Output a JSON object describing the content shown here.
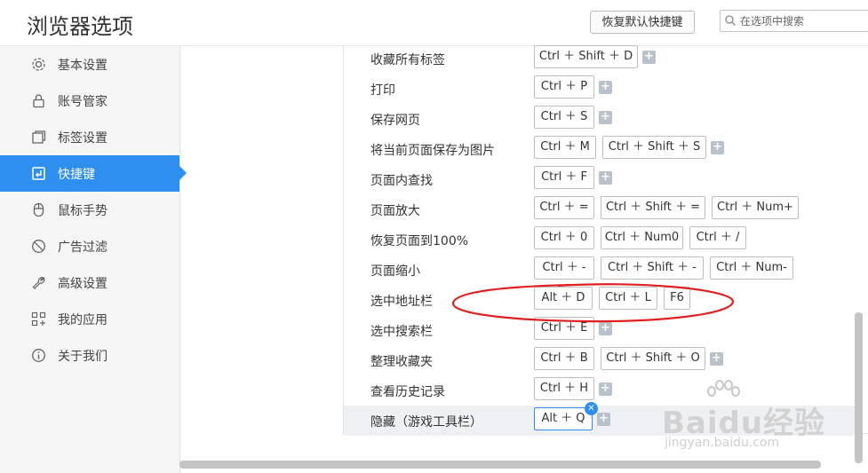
{
  "app": {
    "title": "浏览器选项"
  },
  "header": {
    "restore_button": "恢复默认快捷键",
    "search_placeholder": "在选项中搜索"
  },
  "sidebar": {
    "items": [
      {
        "label": "基本设置",
        "icon": "gear-icon"
      },
      {
        "label": "账号管家",
        "icon": "lock-icon"
      },
      {
        "label": "标签设置",
        "icon": "tabs-icon"
      },
      {
        "label": "快捷键",
        "icon": "shortcut-icon",
        "active": true
      },
      {
        "label": "鼠标手势",
        "icon": "mouse-icon"
      },
      {
        "label": "广告过滤",
        "icon": "block-icon"
      },
      {
        "label": "高级设置",
        "icon": "wrench-icon"
      },
      {
        "label": "我的应用",
        "icon": "apps-icon"
      },
      {
        "label": "关于我们",
        "icon": "info-icon"
      }
    ]
  },
  "shortcuts": [
    {
      "label": "收藏所有标签",
      "keys": [
        "Ctrl ＋ Shift ＋ D"
      ]
    },
    {
      "label": "打印",
      "keys": [
        "Ctrl ＋ P"
      ]
    },
    {
      "label": "保存网页",
      "keys": [
        "Ctrl ＋ S"
      ]
    },
    {
      "label": "将当前页面保存为图片",
      "keys": [
        "Ctrl ＋ M",
        "Ctrl ＋ Shift ＋ S"
      ]
    },
    {
      "label": "页面内查找",
      "keys": [
        "Ctrl ＋ F"
      ]
    },
    {
      "label": "页面放大",
      "keys": [
        "Ctrl ＋ =",
        "Ctrl ＋ Shift ＋ =",
        "Ctrl ＋ Num+"
      ]
    },
    {
      "label": "恢复页面到100%",
      "keys": [
        "Ctrl ＋ 0",
        "Ctrl ＋ Num0",
        "Ctrl ＋ /"
      ]
    },
    {
      "label": "页面缩小",
      "keys": [
        "Ctrl ＋ -",
        "Ctrl ＋ Shift ＋ -",
        "Ctrl ＋ Num-"
      ]
    },
    {
      "label": "选中地址栏",
      "keys": [
        "Alt ＋ D",
        "Ctrl ＋ L",
        "F6"
      ]
    },
    {
      "label": "选中搜索栏",
      "keys": [
        "Ctrl ＋ E"
      ]
    },
    {
      "label": "整理收藏夹",
      "keys": [
        "Ctrl ＋ B",
        "Ctrl ＋ Shift ＋ O"
      ]
    },
    {
      "label": "查看历史记录",
      "keys": [
        "Ctrl ＋ H"
      ]
    },
    {
      "label": "隐藏（游戏工具栏）",
      "keys": [
        "Alt ＋ Q"
      ]
    }
  ],
  "plus_glyph": "+",
  "remove_glyph": "✕",
  "watermark": {
    "logo": "Baidu经验",
    "url": "jingyan.baidu.com"
  },
  "colors": {
    "accent": "#2e8ff0",
    "annotation": "#e02020"
  }
}
